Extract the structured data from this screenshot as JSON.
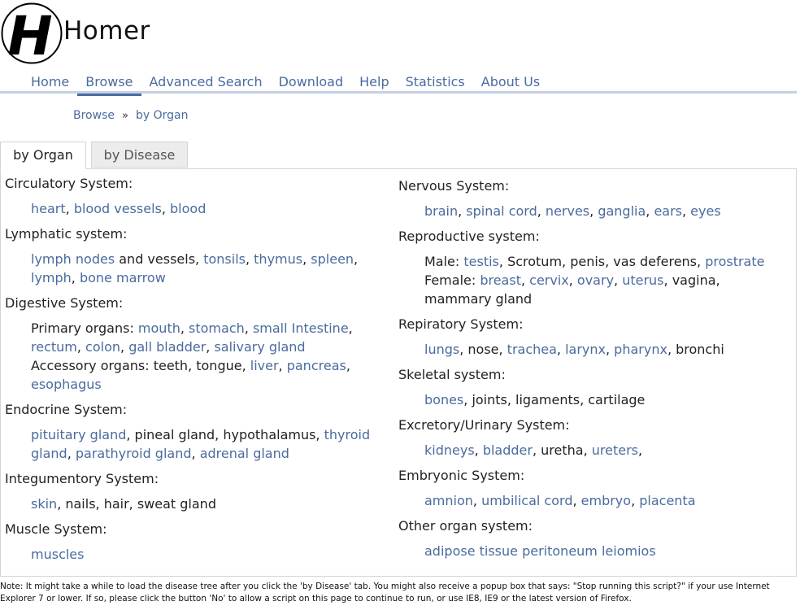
{
  "header": {
    "site_title": "Homer",
    "logo_letter": "H"
  },
  "nav": {
    "items": [
      "Home",
      "Browse",
      "Advanced Search",
      "Download",
      "Help",
      "Statistics",
      "About Us"
    ],
    "active": "Browse"
  },
  "breadcrumb": {
    "root": "Browse",
    "separator": "»",
    "current": "by Organ"
  },
  "tabs": {
    "by_organ": "by Organ",
    "by_disease": "by Disease"
  },
  "left_systems": [
    {
      "title": "Circulatory System:",
      "lines": [
        [
          {
            "t": "heart",
            "link": true
          },
          {
            "t": ", "
          },
          {
            "t": "blood vessels",
            "link": true
          },
          {
            "t": ", "
          },
          {
            "t": "blood",
            "link": true
          }
        ]
      ]
    },
    {
      "title": "Lymphatic system:",
      "lines": [
        [
          {
            "t": "lymph nodes",
            "link": true
          },
          {
            "t": " and vessels, "
          },
          {
            "t": "tonsils",
            "link": true
          },
          {
            "t": ", "
          },
          {
            "t": "thymus",
            "link": true
          },
          {
            "t": ", "
          },
          {
            "t": "spleen",
            "link": true
          },
          {
            "t": ","
          }
        ],
        [
          {
            "t": "lymph",
            "link": true
          },
          {
            "t": ", "
          },
          {
            "t": "bone marrow",
            "link": true
          }
        ]
      ]
    },
    {
      "title": "Digestive System:",
      "lines": [
        [
          {
            "t": "Primary organs: "
          },
          {
            "t": "mouth",
            "link": true
          },
          {
            "t": ", "
          },
          {
            "t": "stomach",
            "link": true
          },
          {
            "t": ", "
          },
          {
            "t": "small Intestine",
            "link": true
          },
          {
            "t": ","
          }
        ],
        [
          {
            "t": "rectum",
            "link": true
          },
          {
            "t": ", "
          },
          {
            "t": "colon",
            "link": true
          },
          {
            "t": ", "
          },
          {
            "t": "gall bladder",
            "link": true
          },
          {
            "t": ", "
          },
          {
            "t": "salivary gland",
            "link": true
          }
        ],
        [
          {
            "t": "Accessory organs: teeth, tongue, "
          },
          {
            "t": "liver",
            "link": true
          },
          {
            "t": ", "
          },
          {
            "t": "pancreas",
            "link": true
          },
          {
            "t": ","
          }
        ],
        [
          {
            "t": "esophagus",
            "link": true
          }
        ]
      ]
    },
    {
      "title": "Endocrine System:",
      "lines": [
        [
          {
            "t": "pituitary gland",
            "link": true
          },
          {
            "t": ", pineal gland, hypothalamus, "
          },
          {
            "t": "thyroid",
            "link": true
          }
        ],
        [
          {
            "t": "gland",
            "link": true
          },
          {
            "t": ", "
          },
          {
            "t": "parathyroid gland",
            "link": true
          },
          {
            "t": ", "
          },
          {
            "t": "adrenal gland",
            "link": true
          }
        ]
      ]
    },
    {
      "title": "Integumentory System:",
      "lines": [
        [
          {
            "t": "skin",
            "link": true
          },
          {
            "t": ", nails, hair, sweat gland"
          }
        ]
      ]
    },
    {
      "title": "Muscle System:",
      "lines": [
        [
          {
            "t": "muscles",
            "link": true
          }
        ]
      ]
    }
  ],
  "right_systems": [
    {
      "title": "Nervous System:",
      "lines": [
        [
          {
            "t": "brain",
            "link": true
          },
          {
            "t": ", "
          },
          {
            "t": "spinal cord",
            "link": true
          },
          {
            "t": ", "
          },
          {
            "t": "nerves",
            "link": true
          },
          {
            "t": ", "
          },
          {
            "t": "ganglia",
            "link": true
          },
          {
            "t": ", "
          },
          {
            "t": "ears",
            "link": true
          },
          {
            "t": ", "
          },
          {
            "t": "eyes",
            "link": true
          }
        ]
      ]
    },
    {
      "title": "Reproductive system:",
      "lines": [
        [
          {
            "t": "Male: "
          },
          {
            "t": "testis",
            "link": true
          },
          {
            "t": ", Scrotum, penis, vas deferens, "
          },
          {
            "t": "prostrate",
            "link": true
          }
        ],
        [
          {
            "t": "Female: "
          },
          {
            "t": "breast",
            "link": true
          },
          {
            "t": ", "
          },
          {
            "t": "cervix",
            "link": true
          },
          {
            "t": ", "
          },
          {
            "t": "ovary",
            "link": true
          },
          {
            "t": ", "
          },
          {
            "t": "uterus",
            "link": true
          },
          {
            "t": ", vagina,"
          }
        ],
        [
          {
            "t": "mammary gland"
          }
        ]
      ]
    },
    {
      "title": "Repiratory System:",
      "lines": [
        [
          {
            "t": "lungs",
            "link": true
          },
          {
            "t": ", nose, "
          },
          {
            "t": "trachea",
            "link": true
          },
          {
            "t": ", "
          },
          {
            "t": "larynx",
            "link": true
          },
          {
            "t": ", "
          },
          {
            "t": "pharynx",
            "link": true
          },
          {
            "t": ", bronchi"
          }
        ]
      ]
    },
    {
      "title": "Skeletal system:",
      "lines": [
        [
          {
            "t": "bones",
            "link": true
          },
          {
            "t": ", joints, ligaments, cartilage"
          }
        ]
      ]
    },
    {
      "title": "Excretory/Urinary System:",
      "lines": [
        [
          {
            "t": "kidneys",
            "link": true
          },
          {
            "t": ", "
          },
          {
            "t": "bladder",
            "link": true
          },
          {
            "t": ", uretha, "
          },
          {
            "t": "ureters",
            "link": true
          },
          {
            "t": ","
          }
        ]
      ]
    },
    {
      "title": "Embryonic System:",
      "lines": [
        [
          {
            "t": "amnion",
            "link": true
          },
          {
            "t": ", "
          },
          {
            "t": "umbilical cord",
            "link": true
          },
          {
            "t": ", "
          },
          {
            "t": "embryo",
            "link": true
          },
          {
            "t": ", "
          },
          {
            "t": "placenta",
            "link": true
          }
        ]
      ]
    },
    {
      "title": "Other organ system:",
      "lines": [
        [
          {
            "t": "adipose tissue",
            "link": true
          },
          {
            "t": " "
          },
          {
            "t": "peritoneum",
            "link": true
          },
          {
            "t": " "
          },
          {
            "t": "leiomios",
            "link": true
          }
        ]
      ]
    }
  ],
  "note": "Note: It might take a while to load the disease tree after you click the 'by Disease' tab. You might also receive a popup box that says: \"Stop running this script?\" if your use Internet Explorer 7 or lower. If so, please click the button 'No' to allow a script on this page to continue to run, or use IE8, IE9 or the latest version of Firefox.",
  "colors": {
    "link": "#4a6b9e",
    "nav_rule": "#c5cfe6",
    "tab_inactive_bg": "#ececec",
    "border": "#d4d4d4"
  }
}
